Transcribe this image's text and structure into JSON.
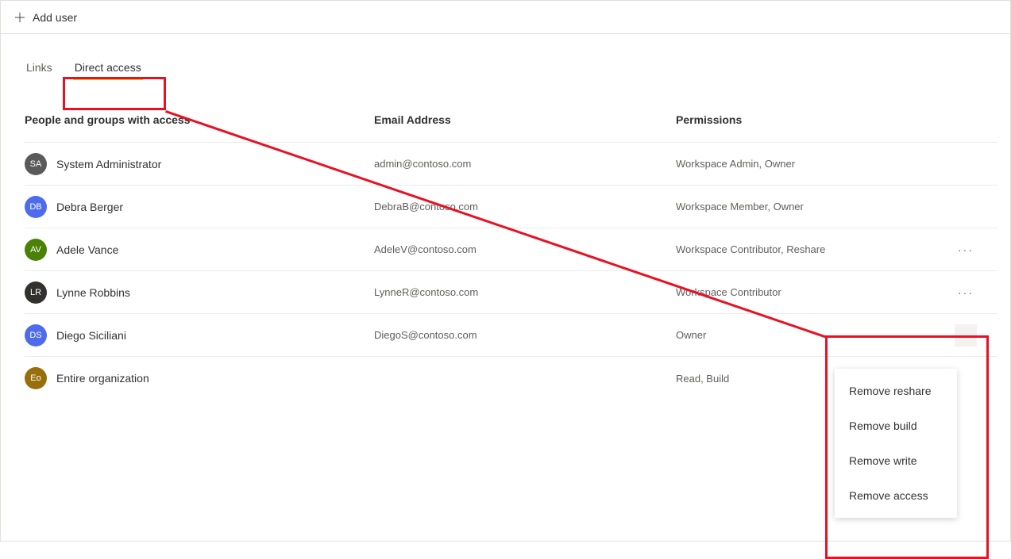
{
  "toolbar": {
    "add_user_label": "Add user"
  },
  "tabs": {
    "links": "Links",
    "direct_access": "Direct access",
    "active": "direct_access"
  },
  "headers": {
    "name": "People and groups with access",
    "email": "Email Address",
    "perm": "Permissions"
  },
  "rows": [
    {
      "initials": "SA",
      "color": "#5a5a5a",
      "name": "System Administrator",
      "email": "admin@contoso.com",
      "perm": "Workspace Admin, Owner",
      "more": false
    },
    {
      "initials": "DB",
      "color": "#4f6bed",
      "name": "Debra Berger",
      "email": "DebraB@contoso.com",
      "perm": "Workspace Member, Owner",
      "more": false
    },
    {
      "initials": "AV",
      "color": "#498205",
      "name": "Adele Vance",
      "email": "AdeleV@contoso.com",
      "perm": "Workspace Contributor, Reshare",
      "more": true
    },
    {
      "initials": "LR",
      "color": "#323130",
      "name": "Lynne Robbins",
      "email": "LynneR@contoso.com",
      "perm": "Workspace Contributor",
      "more": true
    },
    {
      "initials": "DS",
      "color": "#4f6bed",
      "name": "Diego Siciliani",
      "email": "DiegoS@contoso.com",
      "perm": "Owner",
      "more": true,
      "open": true
    },
    {
      "initials": "Eo",
      "color": "#986f0b",
      "name": "Entire organization",
      "email": "",
      "perm": "Read, Build",
      "more": false
    }
  ],
  "menu": {
    "items": [
      "Remove reshare",
      "Remove build",
      "Remove write",
      "Remove access"
    ]
  }
}
